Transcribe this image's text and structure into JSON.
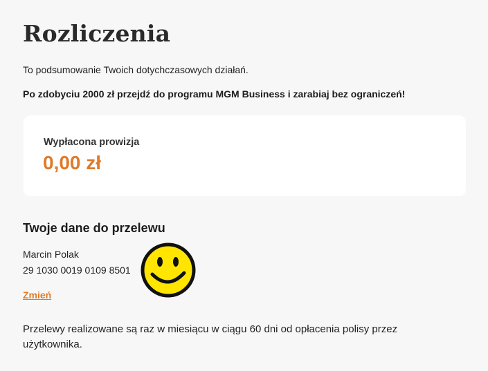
{
  "header": {
    "title": "Rozliczenia"
  },
  "intro": {
    "text": "To podsumowanie Twoich dotychczasowych działań.",
    "promo": "Po zdobyciu 2000 zł przejdź do programu MGM Business i zarabiaj bez ograniczeń!"
  },
  "commission": {
    "label": "Wypłacona prowizja",
    "amount": "0,00 zł"
  },
  "transfer": {
    "heading": "Twoje dane do przelewu",
    "name": "Marcin Polak",
    "account_number": "29 1030 0019 0109 8501",
    "change_label": "Zmień"
  },
  "footer": {
    "note": "Przelewy realizowane są raz w miesiącu w ciągu 60 dni od opłacenia polisy przez użytkownika."
  },
  "colors": {
    "accent": "#e07a29",
    "background": "#f7f7f7",
    "card": "#ffffff",
    "smiley_fill": "#ffe500"
  },
  "icons": {
    "overlay": "smiley-face-icon"
  }
}
